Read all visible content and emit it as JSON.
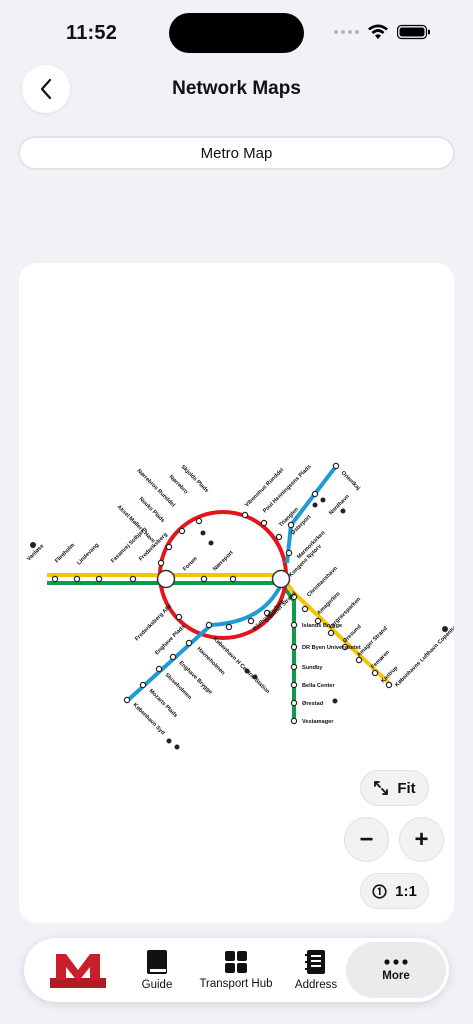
{
  "status": {
    "time": "11:52"
  },
  "header": {
    "title": "Network Maps"
  },
  "segment": {
    "selected": "Metro Map"
  },
  "map": {
    "line_colors": {
      "red": "#e4161b",
      "yellow": "#f5c400",
      "green": "#0f9b48",
      "blue": "#1e9bd7"
    },
    "stations": {
      "vanlose": "Vanløse",
      "flintholm": "Flintholm",
      "lindevang": "Lindevang",
      "fasanvej": "Fasanvej Solbjerg",
      "frederiksberg": "Frederiksberg",
      "forum": "Forum",
      "norreport": "Nørreport",
      "kongens_nytorv": "Kongens Nytorv",
      "christianshavn": "Christianshavn",
      "amagerbro": "Amagerbro",
      "lergravsparken": "Lergravsparken",
      "oresund": "Øresund",
      "amager_strand": "Amager Strand",
      "femoren": "Femøren",
      "kastrup": "Kastrup",
      "lufthavnen": "Københavns Lufthavn Copenhagen Airport",
      "islands_brygge": "Islands Brygge",
      "dr_byen": "DR Byen Universitetet",
      "sundby": "Sundby",
      "bella_center": "Bella Center",
      "orestad": "Ørestad",
      "vestamager": "Vestamager",
      "skjolds_plads": "Skjolds Plads",
      "norrebro": "Nørrebro",
      "norrebros_runddel": "Nørrebros Runddel",
      "nuuks_plads": "Nuuks Plads",
      "aksel_mollers_have": "Aksel Møllers Have",
      "frederiksberg_alle": "Frederiksberg Allé",
      "vibenshus_runddel": "Vibenshus Runddel",
      "poul_henningsens_plads": "Poul Henningsens Plads",
      "trianglen": "Trianglen",
      "osterport": "Østerport",
      "marmorkirken": "Marmorkirken",
      "nordhavn": "Nordhavn",
      "orientkaj": "Orientkaj",
      "gammel_strand": "Gammel Strand",
      "radhuspladsen": "Rådhuspladsen",
      "kobenhavn_h": "København H Central Station",
      "enghave_plads": "Enghave Plads",
      "havneholmen": "Havneholmen",
      "enghave_brygge": "Enghave Brygge",
      "sluseholmen": "Sluseholmen",
      "mozarts_plads": "Mozarts Plads",
      "kobenhavn_syd": "København Syd"
    }
  },
  "controls": {
    "fit": "Fit",
    "zoom_out": "−",
    "zoom_in": "+",
    "reset": "1:1"
  },
  "tabs": [
    {
      "label": "Guide",
      "icon": "book-icon"
    },
    {
      "label": "Transport Hub",
      "icon": "grid-icon"
    },
    {
      "label": "Address",
      "icon": "address-book-icon"
    },
    {
      "label": "More",
      "icon": "ellipsis-icon"
    }
  ]
}
